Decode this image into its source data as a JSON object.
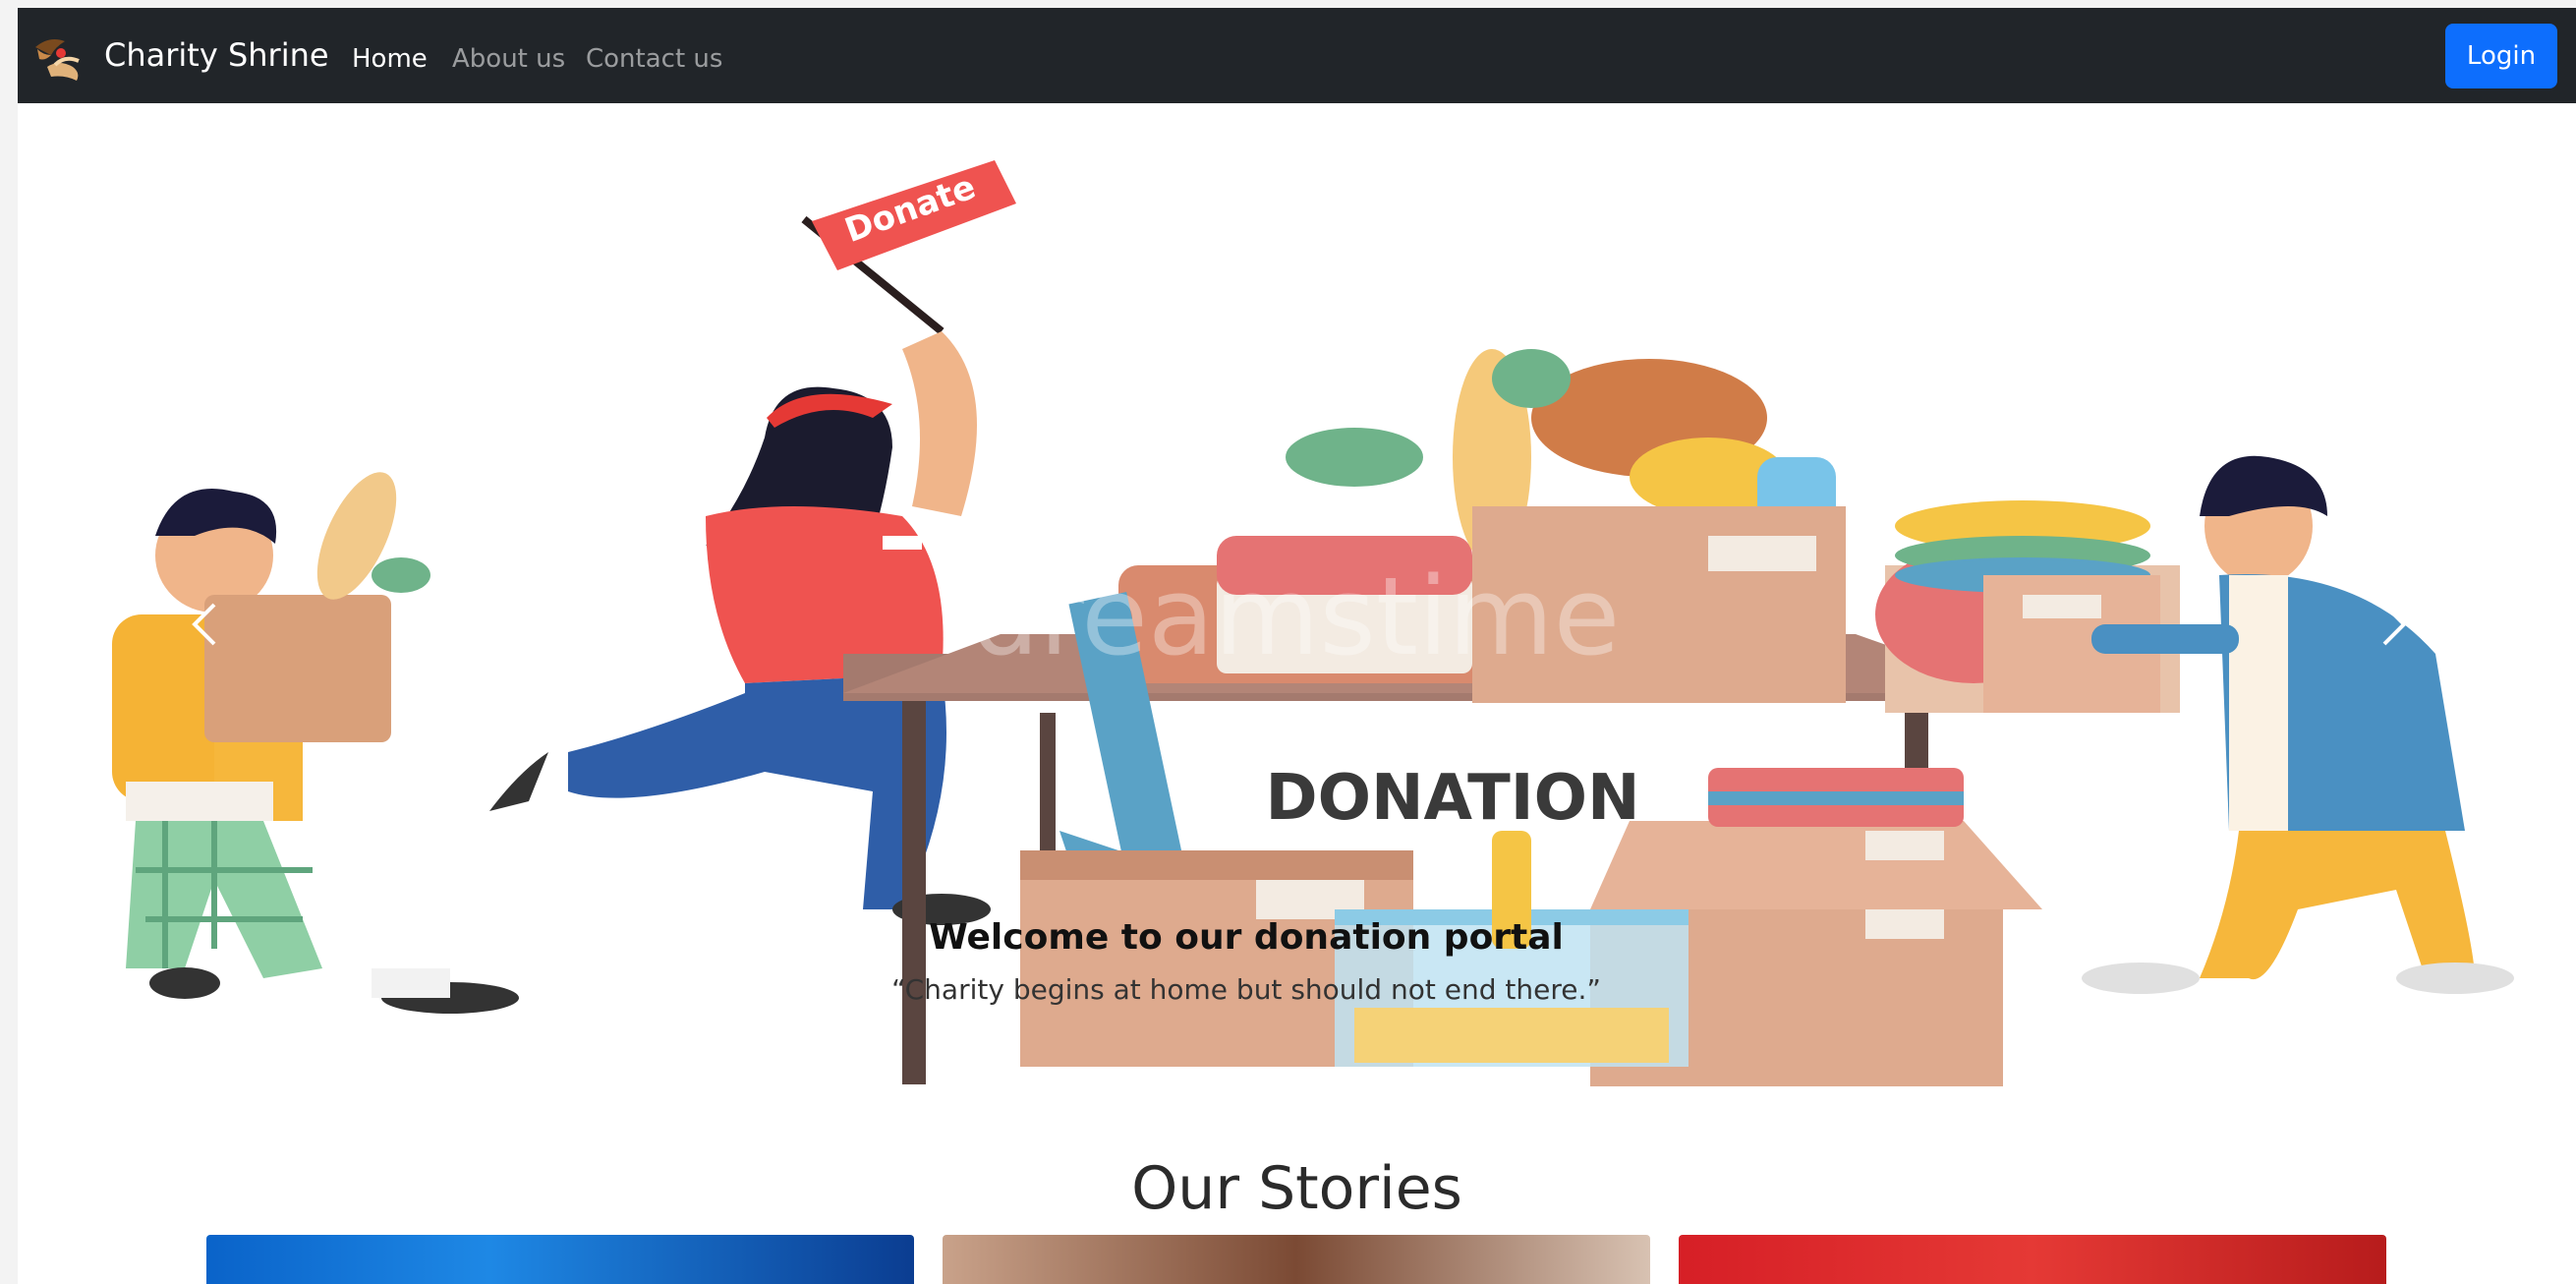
{
  "navbar": {
    "brand_name": "Charity Shrine",
    "links": [
      "Home",
      "About us",
      "Contact us"
    ],
    "active_link": "Home",
    "login_label": "Login",
    "brand_color": "#212529",
    "login_color": "#0d6efd"
  },
  "carousel": {
    "flag_text": "Donate",
    "table_sign": "DONATION",
    "watermark": "dreamstime",
    "caption_title": "Welcome to our donation portal",
    "caption_text": "“Charity begins at home but should not end there.”",
    "prev_icon": "chevron-left-icon",
    "next_icon": "chevron-right-icon"
  },
  "stories": {
    "title": "Our Stories"
  }
}
